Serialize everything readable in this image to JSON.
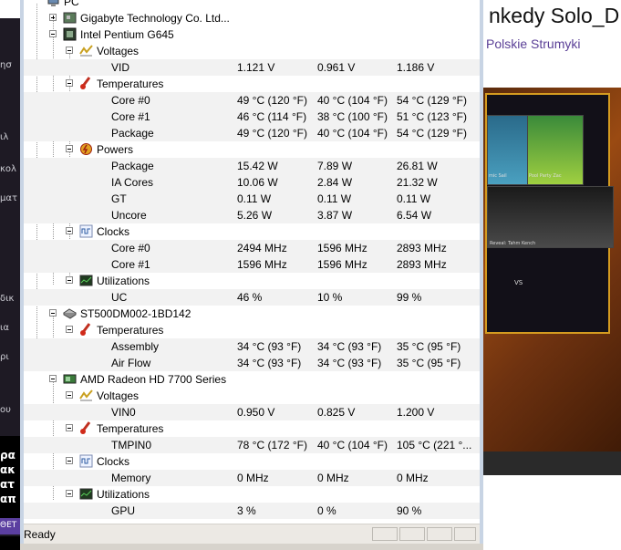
{
  "window": {
    "status_text": "Ready"
  },
  "background_page": {
    "title_fragment": "nkedy Solo_D",
    "subtitle_fragment": "Polskie Strumyki",
    "left_glyphs": [
      "ησ",
      "ιλ",
      "κολ",
      "ματ",
      "δικ",
      "ια",
      "ρι",
      "ου"
    ],
    "left_bold_glyphs": [
      "ρα",
      "ακ",
      "ατ",
      "απ"
    ],
    "left_button_text": "ΘΕΤ",
    "game": {
      "champ1": "mic Sail",
      "champ2": "Pool Party Zac",
      "reveal": "Reveal: Tahm Kench",
      "vs": "VS"
    }
  },
  "tree": [
    {
      "label": "PC",
      "icon": "computer-icon"
    },
    {
      "label": "Gigabyte Technology Co. Ltd...",
      "icon": "motherboard-icon"
    },
    {
      "label": "Intel Pentium G645",
      "icon": "cpu-chip-icon"
    },
    {
      "label": "Voltages",
      "icon": "voltage-icon"
    },
    {
      "label": "VID",
      "v1": "1.121 V",
      "v2": "0.961 V",
      "v3": "1.186 V"
    },
    {
      "label": "Temperatures",
      "icon": "thermometer-icon"
    },
    {
      "label": "Core #0",
      "v1": "49 °C  (120 °F)",
      "v2": "40 °C  (104 °F)",
      "v3": "54 °C  (129 °F)"
    },
    {
      "label": "Core #1",
      "v1": "46 °C  (114 °F)",
      "v2": "38 °C  (100 °F)",
      "v3": "51 °C  (123 °F)"
    },
    {
      "label": "Package",
      "v1": "49 °C  (120 °F)",
      "v2": "40 °C  (104 °F)",
      "v3": "54 °C  (129 °F)"
    },
    {
      "label": "Powers",
      "icon": "power-icon"
    },
    {
      "label": "Package",
      "v1": "15.42 W",
      "v2": "7.89 W",
      "v3": "26.81 W"
    },
    {
      "label": "IA Cores",
      "v1": "10.06 W",
      "v2": "2.84 W",
      "v3": "21.32 W"
    },
    {
      "label": "GT",
      "v1": "0.11 W",
      "v2": "0.11 W",
      "v3": "0.11 W"
    },
    {
      "label": "Uncore",
      "v1": "5.26 W",
      "v2": "3.87 W",
      "v3": "6.54 W"
    },
    {
      "label": "Clocks",
      "icon": "clock-wave-icon"
    },
    {
      "label": "Core #0",
      "v1": "2494 MHz",
      "v2": "1596 MHz",
      "v3": "2893 MHz"
    },
    {
      "label": "Core #1",
      "v1": "1596 MHz",
      "v2": "1596 MHz",
      "v3": "2893 MHz"
    },
    {
      "label": "Utilizations",
      "icon": "utilization-icon"
    },
    {
      "label": "UC",
      "v1": "46 %",
      "v2": "10 %",
      "v3": "99 %"
    },
    {
      "label": "ST500DM002-1BD142",
      "icon": "hard-drive-icon"
    },
    {
      "label": "Temperatures",
      "icon": "thermometer-icon"
    },
    {
      "label": "Assembly",
      "v1": "34 °C  (93 °F)",
      "v2": "34 °C  (93 °F)",
      "v3": "35 °C  (95 °F)"
    },
    {
      "label": "Air Flow",
      "v1": "34 °C  (93 °F)",
      "v2": "34 °C  (93 °F)",
      "v3": "35 °C  (95 °F)"
    },
    {
      "label": "AMD Radeon HD 7700 Series",
      "icon": "gpu-card-icon"
    },
    {
      "label": "Voltages",
      "icon": "voltage-icon"
    },
    {
      "label": "VIN0",
      "v1": "0.950 V",
      "v2": "0.825 V",
      "v3": "1.200 V"
    },
    {
      "label": "Temperatures",
      "icon": "thermometer-icon"
    },
    {
      "label": "TMPIN0",
      "v1": "78 °C  (172 °F)",
      "v2": "40 °C  (104 °F)",
      "v3": "105 °C  (221 °..."
    },
    {
      "label": "Clocks",
      "icon": "clock-wave-icon"
    },
    {
      "label": "Memory",
      "v1": "0 MHz",
      "v2": "0 MHz",
      "v3": "0 MHz"
    },
    {
      "label": "Utilizations",
      "icon": "utilization-icon"
    },
    {
      "label": "GPU",
      "v1": "3 %",
      "v2": "0 %",
      "v3": "90 %"
    }
  ]
}
